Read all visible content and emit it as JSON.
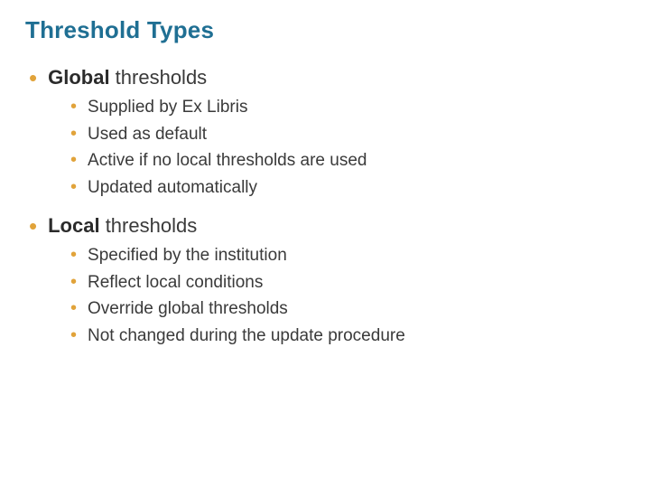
{
  "title": "Threshold Types",
  "sections": [
    {
      "heading_bold": "Global",
      "heading_rest": " thresholds",
      "items": [
        "Supplied by Ex Libris",
        "Used as default",
        "Active if no local thresholds are used",
        "Updated automatically"
      ]
    },
    {
      "heading_bold": "Local",
      "heading_rest": " thresholds",
      "items": [
        "Specified by the institution",
        "Reflect local conditions",
        "Override global thresholds",
        "Not changed during the update procedure"
      ]
    }
  ]
}
